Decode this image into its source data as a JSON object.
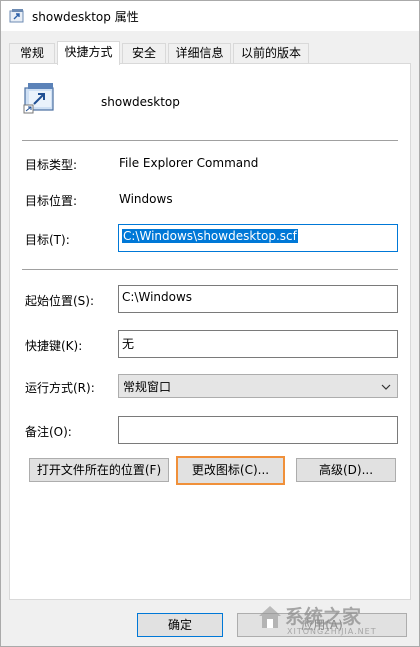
{
  "window": {
    "title": "showdesktop 属性"
  },
  "tabs": [
    {
      "label": "常规"
    },
    {
      "label": "快捷方式"
    },
    {
      "label": "安全"
    },
    {
      "label": "详细信息"
    },
    {
      "label": "以前的版本"
    }
  ],
  "shortcut": {
    "name": "showdesktop",
    "target_type_label": "目标类型:",
    "target_type_value": "File Explorer Command",
    "target_location_label": "目标位置:",
    "target_location_value": "Windows",
    "target_label": "目标(T):",
    "target_value": "C:\\Windows\\showdesktop.scf",
    "start_in_label": "起始位置(S):",
    "start_in_value": "C:\\Windows",
    "hotkey_label": "快捷键(K):",
    "hotkey_value": "无",
    "run_label": "运行方式(R):",
    "run_value": "常规窗口",
    "comment_label": "备注(O):",
    "comment_value": ""
  },
  "buttons": {
    "open_location": "打开文件所在的位置(F)",
    "change_icon": "更改图标(C)...",
    "advanced": "高级(D)...",
    "ok": "确定",
    "apply": "应用(A)"
  },
  "watermark": {
    "brand": "系统之家",
    "url": "XITONGZHIJIA.NET"
  },
  "colors": {
    "selection": "#0078d7",
    "highlight_border": "#f0903a"
  }
}
